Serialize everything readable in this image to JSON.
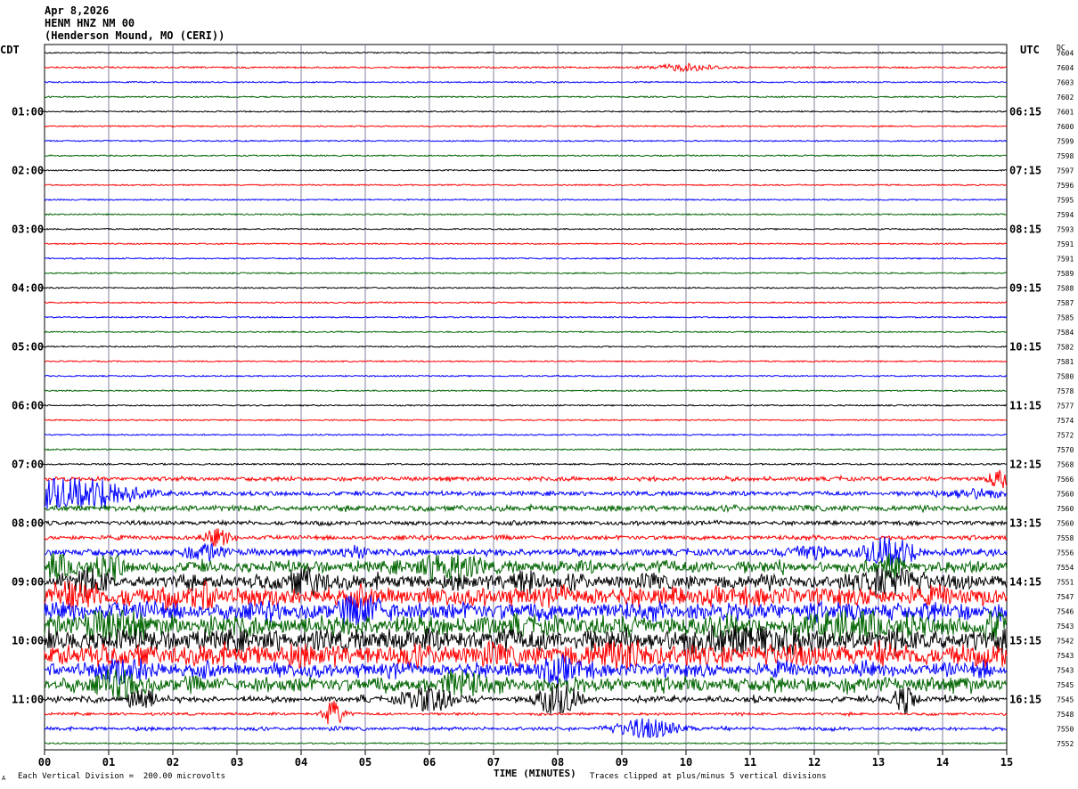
{
  "header": {
    "date": "Apr 8,2026",
    "station": "HENM HNZ NM 00",
    "location": "(Henderson Mound, MO (CERI))"
  },
  "left_tz": "CDT",
  "right_tz": "UTC",
  "dc_label": "DC",
  "footer": {
    "scale": "Each Vertical Division =  200.00 microvolts",
    "clip": "Traces clipped at plus/minus 5 vertical divisions",
    "corner": "A"
  },
  "colors": {
    "black": "#000000",
    "red": "#ff0000",
    "blue": "#0000ff",
    "green": "#006400",
    "grid": "#8080a0"
  },
  "chart_data": {
    "type": "line",
    "xlabel": "TIME (MINUTES)",
    "xlim": [
      0,
      15
    ],
    "x_ticks": [
      "00",
      "01",
      "02",
      "03",
      "04",
      "05",
      "06",
      "07",
      "08",
      "09",
      "10",
      "11",
      "12",
      "13",
      "14",
      "15"
    ],
    "left_time_labels": [
      {
        "row": 4,
        "label": "01:00"
      },
      {
        "row": 8,
        "label": "02:00"
      },
      {
        "row": 12,
        "label": "03:00"
      },
      {
        "row": 16,
        "label": "04:00"
      },
      {
        "row": 20,
        "label": "05:00"
      },
      {
        "row": 24,
        "label": "06:00"
      },
      {
        "row": 28,
        "label": "07:00"
      },
      {
        "row": 32,
        "label": "08:00"
      },
      {
        "row": 36,
        "label": "09:00"
      },
      {
        "row": 40,
        "label": "10:00"
      },
      {
        "row": 44,
        "label": "11:00"
      }
    ],
    "right_time_labels": [
      {
        "row": 4,
        "label": "06:15"
      },
      {
        "row": 8,
        "label": "07:15"
      },
      {
        "row": 12,
        "label": "08:15"
      },
      {
        "row": 16,
        "label": "09:15"
      },
      {
        "row": 20,
        "label": "10:15"
      },
      {
        "row": 24,
        "label": "11:15"
      },
      {
        "row": 28,
        "label": "12:15"
      },
      {
        "row": 32,
        "label": "13:15"
      },
      {
        "row": 36,
        "label": "14:15"
      },
      {
        "row": 40,
        "label": "15:15"
      },
      {
        "row": 44,
        "label": "16:15"
      }
    ],
    "dc_offsets": [
      "7604",
      "7604",
      "7603",
      "7602",
      "7601",
      "7600",
      "7599",
      "7598",
      "7597",
      "7596",
      "7595",
      "7594",
      "7593",
      "7591",
      "7591",
      "7589",
      "7588",
      "7587",
      "7585",
      "7584",
      "7582",
      "7581",
      "7580",
      "7578",
      "7577",
      "7574",
      "7572",
      "7570",
      "7568",
      "7566",
      "7560",
      "7560",
      "7560",
      "7558",
      "7556",
      "7554",
      "7551",
      "7547",
      "7546",
      "7543",
      "7542",
      "7543",
      "7543",
      "7545",
      "7545",
      "7548",
      "7550",
      "7552"
    ],
    "series_color_cycle": [
      "black",
      "red",
      "blue",
      "green"
    ],
    "trace_activity": [
      [
        0.05,
        0,
        []
      ],
      [
        0.06,
        0,
        [
          [
            10,
            0.5,
            0.25
          ]
        ]
      ],
      [
        0.05,
        0,
        []
      ],
      [
        0.05,
        0,
        []
      ],
      [
        0.05,
        0,
        []
      ],
      [
        0.05,
        0,
        []
      ],
      [
        0.05,
        0,
        []
      ],
      [
        0.05,
        0,
        []
      ],
      [
        0.05,
        0,
        []
      ],
      [
        0.05,
        0,
        []
      ],
      [
        0.05,
        0,
        []
      ],
      [
        0.05,
        0,
        []
      ],
      [
        0.05,
        0,
        []
      ],
      [
        0.05,
        0,
        []
      ],
      [
        0.05,
        0,
        []
      ],
      [
        0.05,
        0,
        []
      ],
      [
        0.05,
        0,
        []
      ],
      [
        0.05,
        0,
        []
      ],
      [
        0.05,
        0,
        []
      ],
      [
        0.05,
        0,
        []
      ],
      [
        0.05,
        0,
        []
      ],
      [
        0.05,
        0,
        []
      ],
      [
        0.05,
        0,
        []
      ],
      [
        0.05,
        0,
        []
      ],
      [
        0.05,
        0,
        []
      ],
      [
        0.05,
        0,
        []
      ],
      [
        0.05,
        0,
        []
      ],
      [
        0.05,
        0,
        []
      ],
      [
        0.06,
        0,
        []
      ],
      [
        0.1,
        0.15,
        [
          [
            14.9,
            0.2,
            0.6
          ]
        ]
      ],
      [
        0.12,
        0.1,
        [
          [
            0.3,
            0.3,
            3.5
          ],
          [
            0.8,
            0.6,
            1.2
          ],
          [
            14.5,
            0.5,
            0.3
          ]
        ]
      ],
      [
        0.15,
        0.15,
        []
      ],
      [
        0.12,
        0.1,
        []
      ],
      [
        0.12,
        0.1,
        [
          [
            2.7,
            0.2,
            0.6
          ]
        ]
      ],
      [
        0.18,
        0.2,
        [
          [
            2.5,
            0.3,
            0.5
          ],
          [
            4.8,
            0.2,
            0.4
          ],
          [
            11.9,
            0.3,
            0.5
          ],
          [
            13.2,
            0.4,
            1.0
          ]
        ]
      ],
      [
        0.25,
        0.5,
        [
          [
            0.2,
            0.2,
            0.8
          ],
          [
            1.0,
            0.2,
            0.8
          ],
          [
            6.3,
            0.4,
            1.0
          ],
          [
            13.2,
            0.2,
            0.6
          ]
        ]
      ],
      [
        0.3,
        0.6,
        [
          [
            0.7,
            0.2,
            0.8
          ],
          [
            4.1,
            0.3,
            0.8
          ],
          [
            7.5,
            0.2,
            0.8
          ],
          [
            13.2,
            0.4,
            0.9
          ]
        ]
      ],
      [
        0.45,
        0.7,
        [
          [
            0.5,
            0.3,
            0.7
          ],
          [
            2.5,
            0.2,
            0.6
          ]
        ]
      ],
      [
        0.4,
        0.7,
        [
          [
            5.0,
            0.3,
            0.8
          ]
        ]
      ],
      [
        0.45,
        0.8,
        [
          [
            1.0,
            0.4,
            0.8
          ],
          [
            12.5,
            0.4,
            1.0
          ],
          [
            14.8,
            0.2,
            0.8
          ]
        ]
      ],
      [
        0.5,
        0.8,
        [
          [
            10.5,
            0.5,
            0.8
          ],
          [
            11.4,
            0.3,
            0.9
          ]
        ]
      ],
      [
        0.5,
        0.8,
        [
          [
            9.0,
            0.4,
            0.7
          ]
        ]
      ],
      [
        0.3,
        0.6,
        [
          [
            1.3,
            0.4,
            0.8
          ],
          [
            8.0,
            0.3,
            0.8
          ]
        ]
      ],
      [
        0.3,
        0.7,
        [
          [
            1.2,
            0.3,
            0.8
          ],
          [
            6.5,
            0.3,
            0.8
          ]
        ]
      ],
      [
        0.1,
        0.3,
        [
          [
            1.5,
            0.2,
            1.0
          ],
          [
            6.0,
            0.4,
            0.9
          ],
          [
            8.0,
            0.3,
            1.3
          ],
          [
            13.4,
            0.2,
            0.9
          ]
        ]
      ],
      [
        0.06,
        0.1,
        [
          [
            4.5,
            0.15,
            1.0
          ]
        ]
      ],
      [
        0.07,
        0.15,
        [
          [
            9.4,
            0.5,
            0.7
          ]
        ]
      ],
      [
        0.05,
        0,
        []
      ]
    ]
  }
}
